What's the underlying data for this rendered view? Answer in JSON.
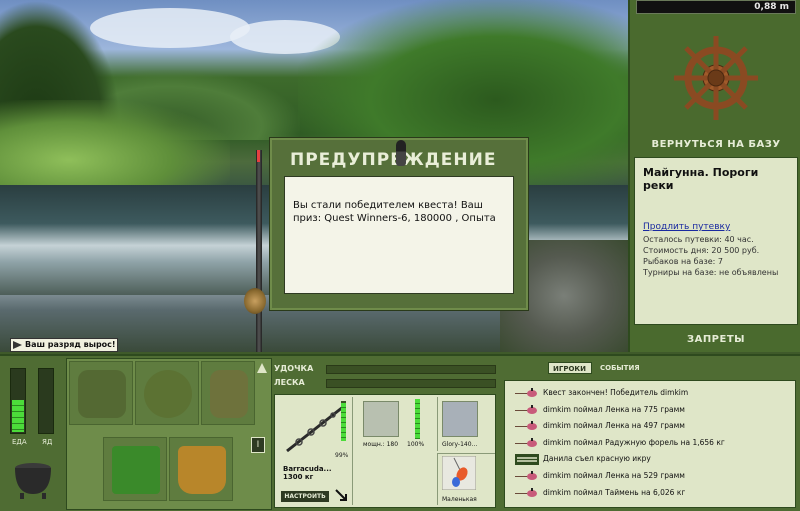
{
  "game": {
    "depth": "0,88 m"
  },
  "dialog": {
    "title": "ПРЕДУПРЕЖДЕНИЕ",
    "message": "Вы стали победителем квеста! Ваш приз: Quest Winners-6, 180000 , Опыта"
  },
  "notification": {
    "text": "Ваш разряд вырос!"
  },
  "right_panel": {
    "return_base_label": "ВЕРНУТЬСЯ НА БАЗУ",
    "location_title": "Майгунна. Пороги реки",
    "extend_trip_link": "Продлить путевку",
    "info": [
      "Осталось путевки: 40 час.",
      "Стоимость дня: 20 500 руб.",
      "Рыбаков на базе: 7",
      "Турниры на базе: не объявлены"
    ],
    "bans_label": "ЗАПРЕТЫ"
  },
  "stats": {
    "food_label": "ЕДА",
    "poison_label": "ЯД",
    "food_level": 0.5,
    "poison_level": 0.0
  },
  "inventory": {
    "side_button": "I"
  },
  "gear": {
    "rod_label": "УДОЧКА",
    "line_label": "ЛЕСКА",
    "rod": {
      "name": "Barracuda...",
      "weight": "1300 кг",
      "durability": "99%",
      "setup_label": "НАСТРОИТЬ"
    },
    "reel": {
      "power": "мощн.: 180",
      "durability": "100%"
    },
    "line": {
      "name": "Glory-140..."
    },
    "lure": {
      "name": "Маленькая"
    }
  },
  "events": {
    "tabs": [
      "ИГРОКИ",
      "СОБЫТИЯ"
    ],
    "active_tab": "ИГРОКИ",
    "items": [
      {
        "text": "Квест закончен! Победитель dimkim",
        "icon": "fishing-float-icon"
      },
      {
        "text": "dimkim поймал Ленка на 775 грамм",
        "icon": "fishing-float-icon"
      },
      {
        "text": "dimkim поймал Ленка на 497 грамм",
        "icon": "fishing-float-icon"
      },
      {
        "text": "dimkim поймал Радужную форель на 1,656 кг",
        "icon": "fishing-float-icon"
      },
      {
        "text": "Данила съел красную икру",
        "icon": "caviar-icon"
      },
      {
        "text": "dimkim поймал Ленка на 529 грамм",
        "icon": "fishing-float-icon"
      },
      {
        "text": "dimkim поймал Таймень на 6,026 кг",
        "icon": "fishing-float-icon"
      }
    ]
  },
  "colors": {
    "panel_green": "#4f6c33",
    "panel_light": "#dfe6c8",
    "bar_green": "#4cdc3a",
    "link_blue": "#1a2aa0"
  }
}
